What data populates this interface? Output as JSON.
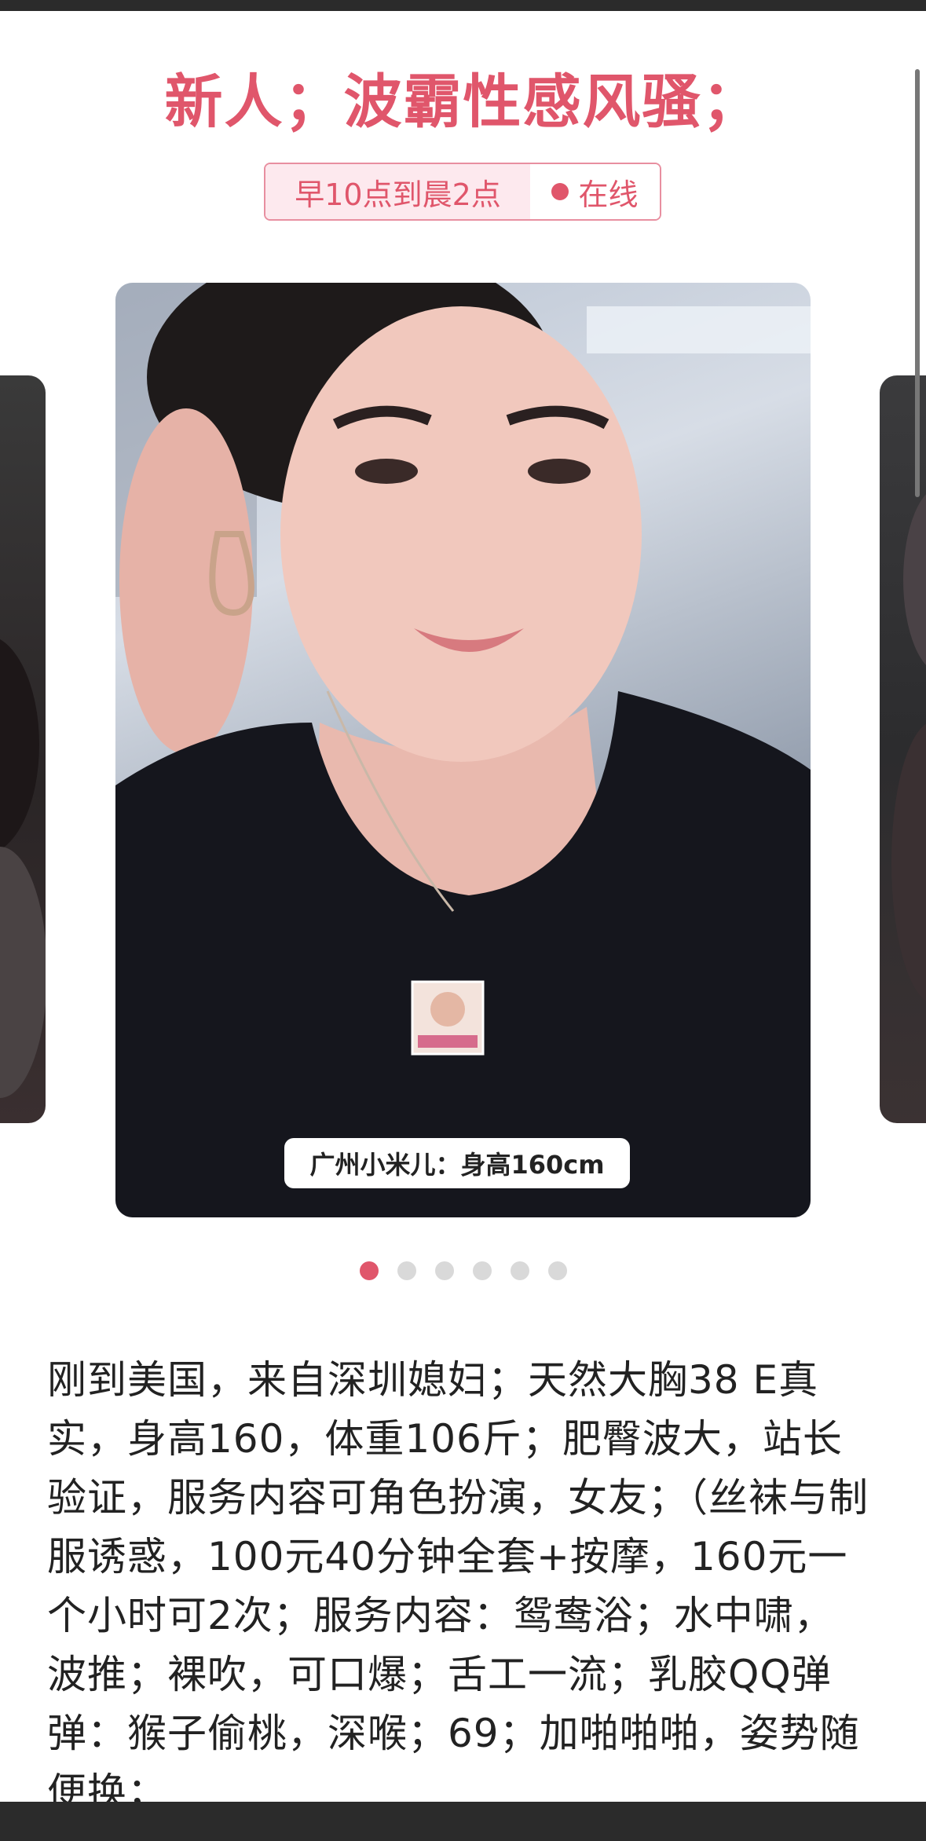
{
  "profile": {
    "title": "新人；波霸性感风骚；",
    "hours": "早10点到晨2点",
    "status": "在线",
    "caption": "广州小米儿：身高160cm",
    "carousel": {
      "total": 6,
      "active_index": 0
    },
    "description": "刚到美国，来自深圳媳妇；天然大胸38 E真实，身高160，体重106斤；肥臀波大，站长验证，服务内容可角色扮演，女友；（丝袜与制服诱惑，100元40分钟全套+按摩，160元一个小时可2次；服务内容：鸳鸯浴；水中啸， 波推；裸吹，可口爆；舌工一流；乳胶QQ弹弹：猴子偷桃，深喉；69；加啪啪啪，姿势随便换；"
  },
  "colors": {
    "accent": "#e0566b",
    "badge_bg": "#fde9ee",
    "dot_inactive": "#d9d9d9"
  },
  "icons": {
    "status_dot": "online-dot-icon"
  }
}
